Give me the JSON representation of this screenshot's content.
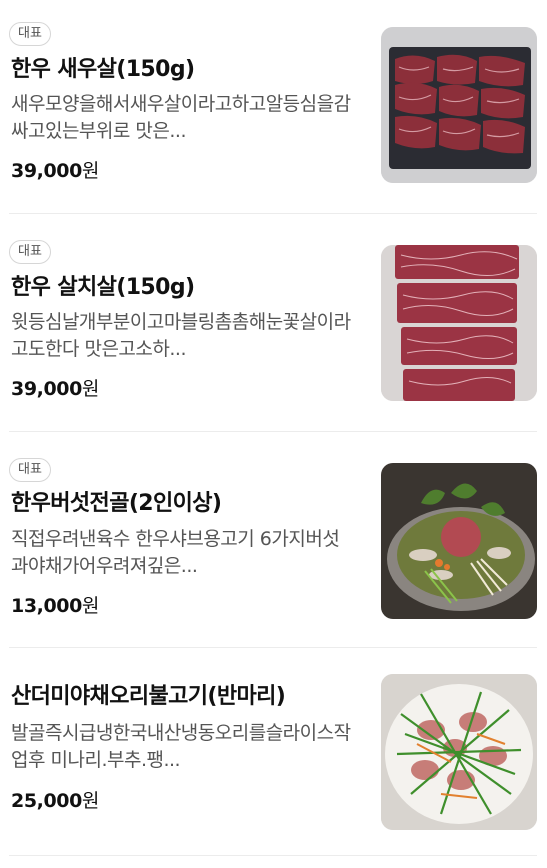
{
  "menu": {
    "items": [
      {
        "badge": "대표",
        "title": "한우 새우살(150g)",
        "description": "새우모양을해서새우살이라고하고알등심을감싸고있는부위로 맛은...",
        "price": "39,000",
        "currency": "원",
        "image": "beef-shrimp-cut-photo"
      },
      {
        "badge": "대표",
        "title": "한우 살치살(150g)",
        "description": "윗등심날개부분이고마블링촘촘해눈꽃살이라고도한다 맛은고소하...",
        "price": "39,000",
        "currency": "원",
        "image": "beef-chuck-flap-photo"
      },
      {
        "badge": "대표",
        "title": "한우버섯전골(2인이상)",
        "description": "직접우려낸육수 한우샤브용고기 6가지버섯과야채가어우려져깊은...",
        "price": "13,000",
        "currency": "원",
        "image": "mushroom-hotpot-photo"
      },
      {
        "badge": "",
        "title": "산더미야채오리불고기(반마리)",
        "description": "발골즉시급냉한국내산냉동오리를슬라이스작업후 미나리.부추.팽...",
        "price": "25,000",
        "currency": "원",
        "image": "duck-bulgogi-photo"
      }
    ]
  }
}
